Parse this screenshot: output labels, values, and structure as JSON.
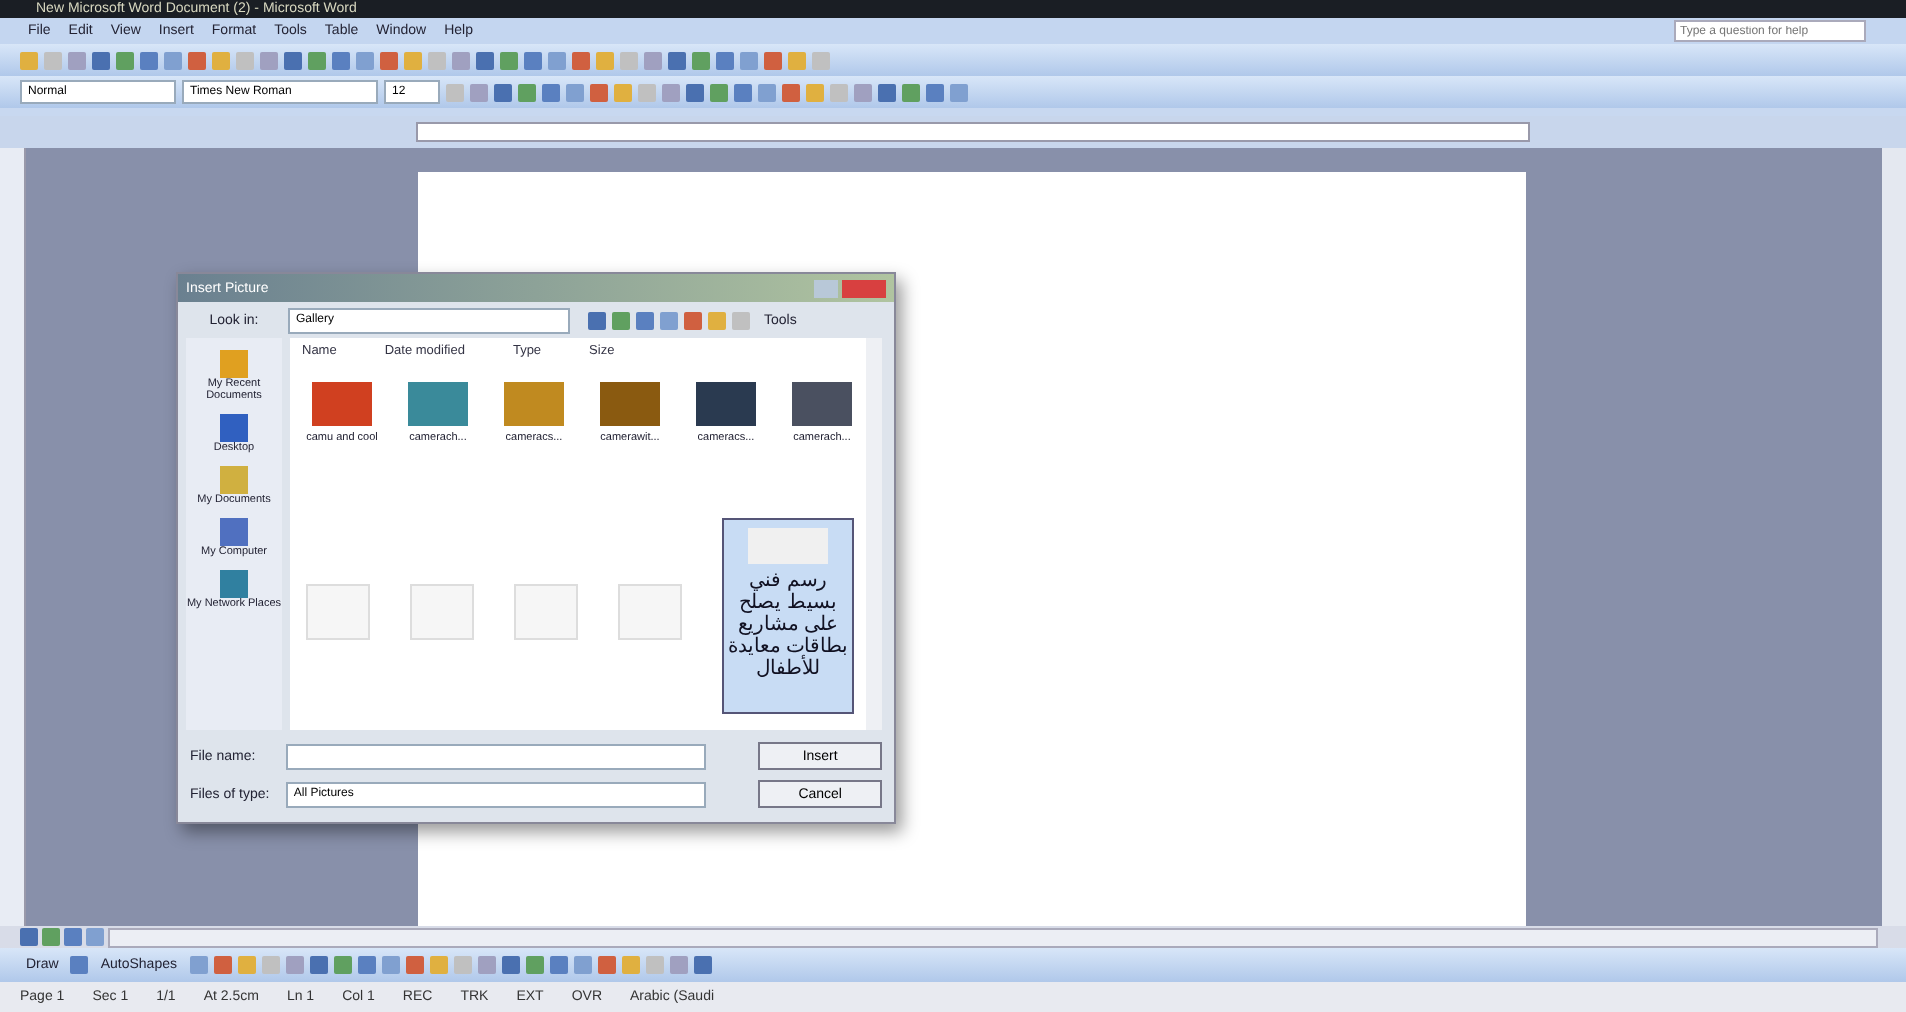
{
  "window": {
    "title": "New Microsoft Word Document (2) - Microsoft Word"
  },
  "menu": [
    "File",
    "Edit",
    "View",
    "Insert",
    "Format",
    "Tools",
    "Table",
    "Window",
    "Help"
  ],
  "help_box": {
    "placeholder": "Type a question for help"
  },
  "formatting": {
    "style": "Normal",
    "font": "Times New Roman",
    "size": "12"
  },
  "dialog": {
    "title": "Insert Picture",
    "look_in_label": "Look in:",
    "look_in": "Gallery",
    "tools": "Tools",
    "places": [
      "My Recent Documents",
      "Desktop",
      "My Documents",
      "My Computer",
      "My Network Places"
    ],
    "columns": [
      "Name",
      "Date modified",
      "Type",
      "Size"
    ],
    "files": [
      {
        "name": "camu and cool",
        "color": "#d04020"
      },
      {
        "name": "camerach...",
        "color": "#3a8a9a"
      },
      {
        "name": "cameracs...",
        "color": "#c08a20"
      },
      {
        "name": "camerawit...",
        "color": "#8a5a10"
      },
      {
        "name": "cameracs...",
        "color": "#2a3a50"
      },
      {
        "name": "camerach...",
        "color": "#4a5060"
      }
    ],
    "tooltip": "رسم فني بسيط يصلح على مشاريع بطاقات معايدة للأطفال",
    "file_name_label": "File name:",
    "files_of_type_label": "Files of type:",
    "files_of_type": "All Pictures",
    "buttons": [
      "Insert",
      "Cancel"
    ]
  },
  "drawing_toolbar": {
    "draw": "Draw",
    "autoshapes": "AutoShapes"
  },
  "status_bar": [
    "Page 1",
    "Sec 1",
    "1/1",
    "At 2.5cm",
    "Ln 1",
    "Col 1",
    "REC",
    "TRK",
    "EXT",
    "OVR",
    "Arabic (Saudi"
  ]
}
